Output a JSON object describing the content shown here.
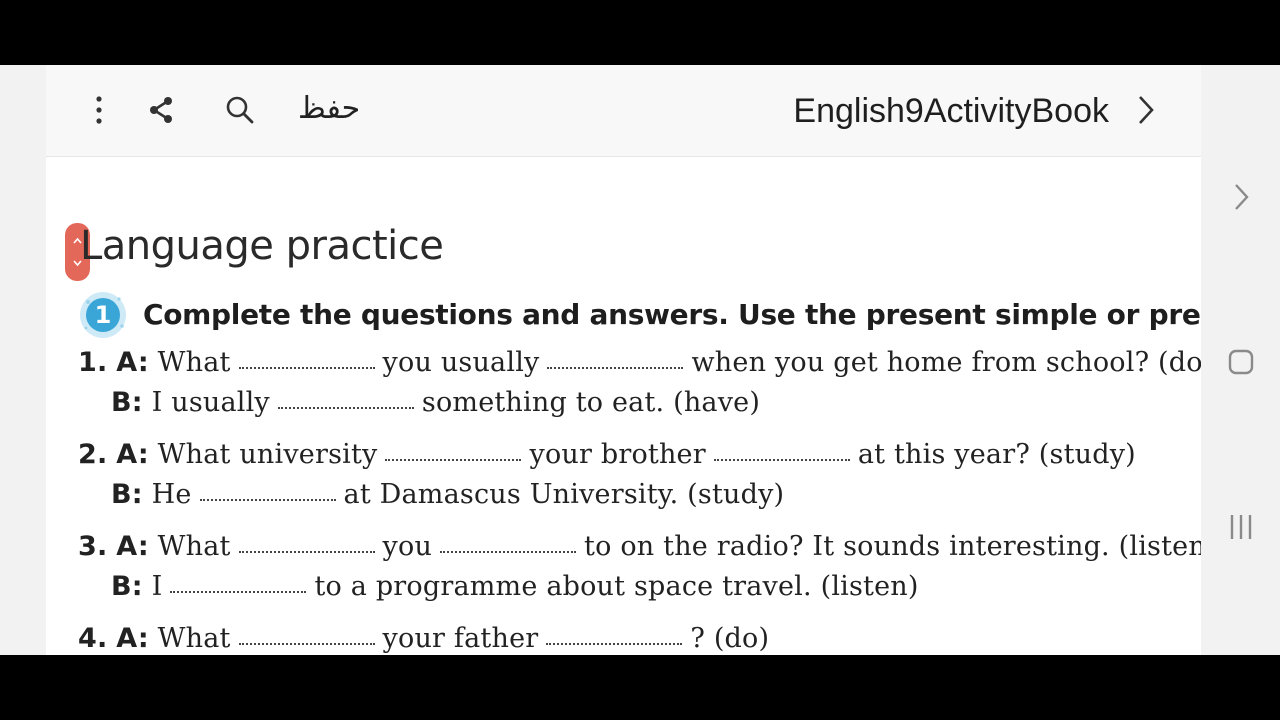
{
  "toolbar": {
    "more_icon": "more-vert-icon",
    "share_icon": "share-icon",
    "search_icon": "search-icon",
    "save_label": "حفظ",
    "doc_title": "English9ActivityBook",
    "next_icon": "chevron-right-icon"
  },
  "page": {
    "heading_first": "L",
    "heading_rest": "anguage practice",
    "exercise_number": "1",
    "exercise_instruction": "Complete the questions and answers. Use the present simple or present",
    "items": [
      {
        "num": "1.",
        "a_speaker": "A:",
        "a_parts": [
          "What",
          "you usually",
          "when you get home from school? (do"
        ],
        "b_speaker": "B:",
        "b_parts": [
          "I usually",
          "something to eat. (have)"
        ]
      },
      {
        "num": "2.",
        "a_speaker": "A:",
        "a_parts": [
          "What university",
          "your brother",
          "at this year? (study)"
        ],
        "b_speaker": "B:",
        "b_parts": [
          "He",
          "at Damascus University. (study)"
        ]
      },
      {
        "num": "3.",
        "a_speaker": "A:",
        "a_parts": [
          "What",
          "you",
          "to on the radio? It sounds interesting. (listen"
        ],
        "b_speaker": "B:",
        "b_parts": [
          "I",
          "to a programme about space travel. (listen)"
        ]
      },
      {
        "num": "4.",
        "a_speaker": "A:",
        "a_parts": [
          "What",
          "your father",
          "? (do)"
        ]
      }
    ]
  },
  "nav": {
    "forward_icon": "chevron-right-icon",
    "home_icon": "home-square-icon",
    "recents_icon": "recents-icon"
  },
  "colors": {
    "scroll_handle": "#e4685a",
    "badge": "#3aa6d8"
  }
}
